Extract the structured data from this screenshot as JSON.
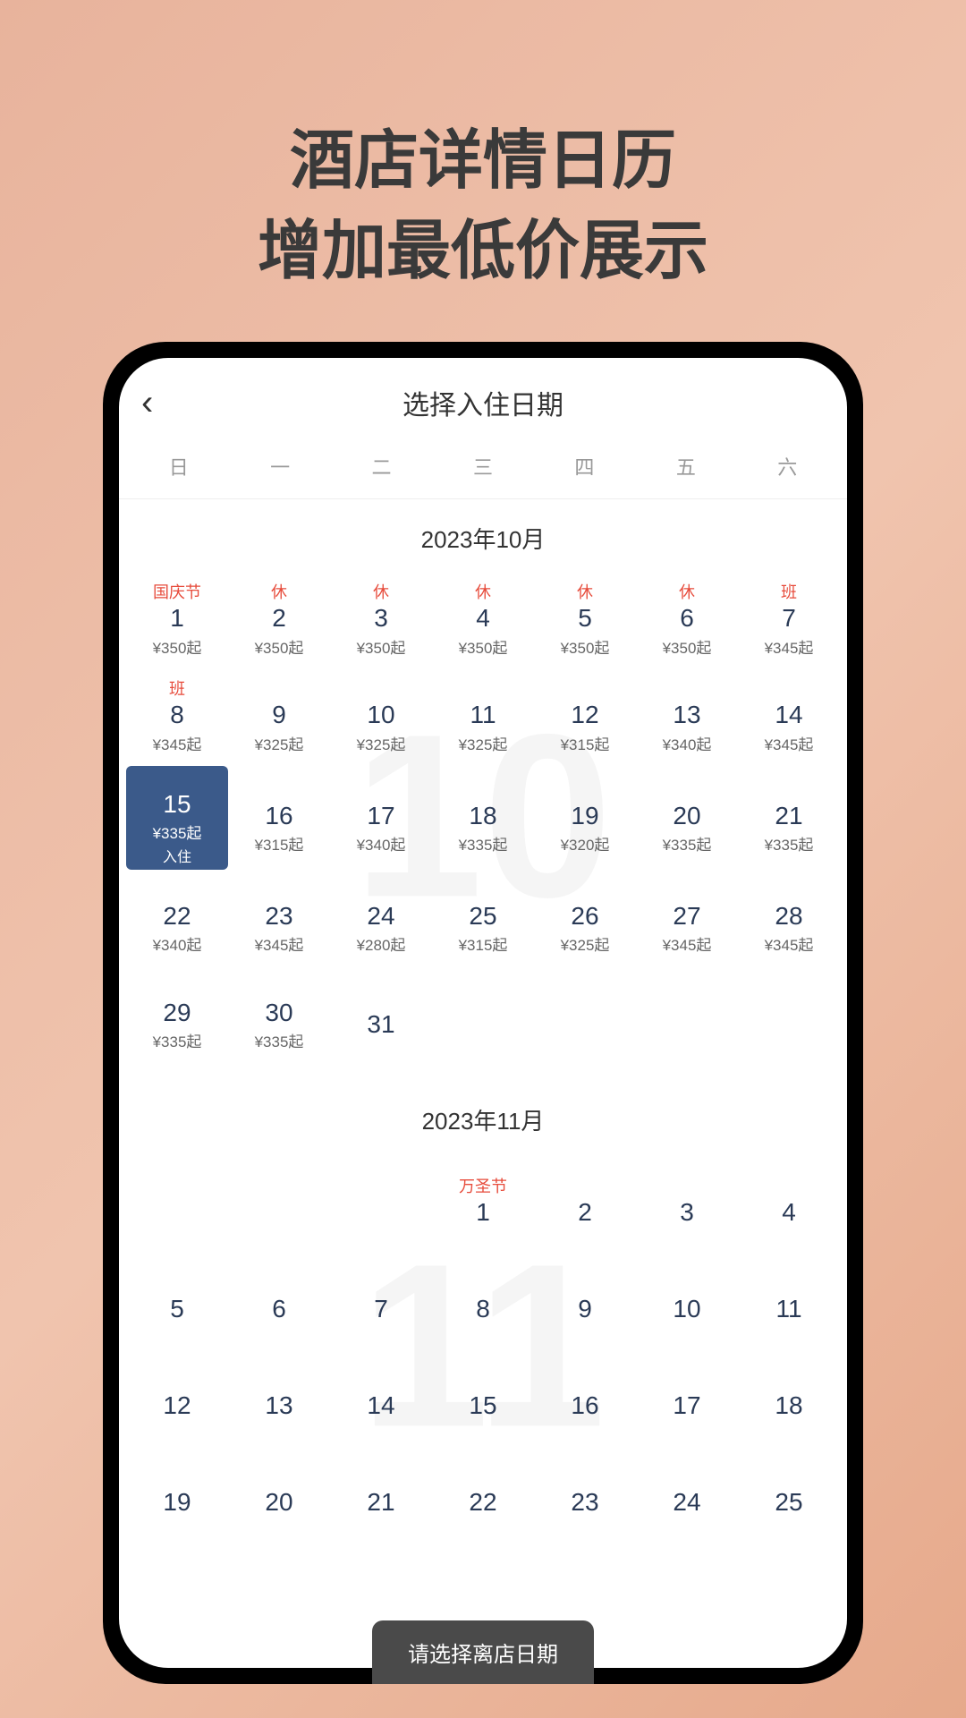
{
  "promo": {
    "line1": "酒店详情日历",
    "line2": "增加最低价展示"
  },
  "header": {
    "title": "选择入住日期"
  },
  "weekdays": [
    "日",
    "一",
    "二",
    "三",
    "四",
    "五",
    "六"
  ],
  "months": [
    {
      "title": "2023年10月",
      "bgNumber": "10",
      "startOffset": 0,
      "days": [
        {
          "n": "1",
          "label": "国庆节",
          "price": "¥350起"
        },
        {
          "n": "2",
          "label": "休",
          "price": "¥350起"
        },
        {
          "n": "3",
          "label": "休",
          "price": "¥350起"
        },
        {
          "n": "4",
          "label": "休",
          "price": "¥350起"
        },
        {
          "n": "5",
          "label": "休",
          "price": "¥350起"
        },
        {
          "n": "6",
          "label": "休",
          "price": "¥350起"
        },
        {
          "n": "7",
          "label": "班",
          "price": "¥345起"
        },
        {
          "n": "8",
          "label": "班",
          "price": "¥345起"
        },
        {
          "n": "9",
          "label": "",
          "price": "¥325起"
        },
        {
          "n": "10",
          "label": "",
          "price": "¥325起"
        },
        {
          "n": "11",
          "label": "",
          "price": "¥325起"
        },
        {
          "n": "12",
          "label": "",
          "price": "¥315起"
        },
        {
          "n": "13",
          "label": "",
          "price": "¥340起"
        },
        {
          "n": "14",
          "label": "",
          "price": "¥345起"
        },
        {
          "n": "15",
          "label": "",
          "price": "¥335起",
          "extra": "入住",
          "selected": true
        },
        {
          "n": "16",
          "label": "",
          "price": "¥315起"
        },
        {
          "n": "17",
          "label": "",
          "price": "¥340起"
        },
        {
          "n": "18",
          "label": "",
          "price": "¥335起"
        },
        {
          "n": "19",
          "label": "",
          "price": "¥320起"
        },
        {
          "n": "20",
          "label": "",
          "price": "¥335起"
        },
        {
          "n": "21",
          "label": "",
          "price": "¥335起"
        },
        {
          "n": "22",
          "label": "",
          "price": "¥340起"
        },
        {
          "n": "23",
          "label": "",
          "price": "¥345起"
        },
        {
          "n": "24",
          "label": "",
          "price": "¥280起"
        },
        {
          "n": "25",
          "label": "",
          "price": "¥315起"
        },
        {
          "n": "26",
          "label": "",
          "price": "¥325起"
        },
        {
          "n": "27",
          "label": "",
          "price": "¥345起"
        },
        {
          "n": "28",
          "label": "",
          "price": "¥345起"
        },
        {
          "n": "29",
          "label": "",
          "price": "¥335起"
        },
        {
          "n": "30",
          "label": "",
          "price": "¥335起"
        },
        {
          "n": "31",
          "label": "",
          "price": ""
        }
      ]
    },
    {
      "title": "2023年11月",
      "bgNumber": "11",
      "startOffset": 3,
      "days": [
        {
          "n": "1",
          "label": "万圣节",
          "price": ""
        },
        {
          "n": "2",
          "label": "",
          "price": ""
        },
        {
          "n": "3",
          "label": "",
          "price": ""
        },
        {
          "n": "4",
          "label": "",
          "price": ""
        },
        {
          "n": "5",
          "label": "",
          "price": ""
        },
        {
          "n": "6",
          "label": "",
          "price": ""
        },
        {
          "n": "7",
          "label": "",
          "price": ""
        },
        {
          "n": "8",
          "label": "",
          "price": ""
        },
        {
          "n": "9",
          "label": "",
          "price": ""
        },
        {
          "n": "10",
          "label": "",
          "price": ""
        },
        {
          "n": "11",
          "label": "",
          "price": ""
        },
        {
          "n": "12",
          "label": "",
          "price": ""
        },
        {
          "n": "13",
          "label": "",
          "price": ""
        },
        {
          "n": "14",
          "label": "",
          "price": ""
        },
        {
          "n": "15",
          "label": "",
          "price": ""
        },
        {
          "n": "16",
          "label": "",
          "price": ""
        },
        {
          "n": "17",
          "label": "",
          "price": ""
        },
        {
          "n": "18",
          "label": "",
          "price": ""
        },
        {
          "n": "19",
          "label": "",
          "price": ""
        },
        {
          "n": "20",
          "label": "",
          "price": ""
        },
        {
          "n": "21",
          "label": "",
          "price": ""
        },
        {
          "n": "22",
          "label": "",
          "price": ""
        },
        {
          "n": "23",
          "label": "",
          "price": ""
        },
        {
          "n": "24",
          "label": "",
          "price": ""
        },
        {
          "n": "25",
          "label": "",
          "price": ""
        }
      ]
    }
  ],
  "bottomBanner": "请选择离店日期"
}
